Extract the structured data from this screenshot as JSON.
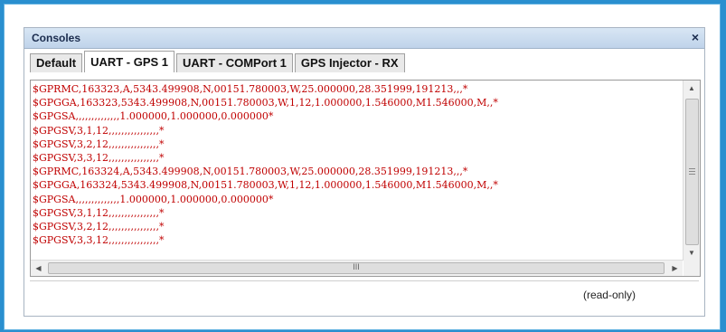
{
  "panel": {
    "title": "Consoles",
    "close_glyph": "×"
  },
  "tabs": [
    {
      "label": "Default",
      "active": false
    },
    {
      "label": "UART - GPS 1",
      "active": true
    },
    {
      "label": "UART - COMPort 1",
      "active": false
    },
    {
      "label": "GPS Injector - RX",
      "active": false
    }
  ],
  "console": {
    "text_color": "#c00000",
    "lines": [
      "$GPRMC,163323,A,5343.499908,N,00151.780003,W,25.000000,28.351999,191213,,,*",
      "$GPGGA,163323,5343.499908,N,00151.780003,W,1,12,1.000000,1.546000,M1.546000,M,,*",
      "$GPGSA,,,,,,,,,,,,,,1.000000,1.000000,0.000000*",
      "$GPGSV,3,1,12,,,,,,,,,,,,,,,,*",
      "$GPGSV,3,2,12,,,,,,,,,,,,,,,,*",
      "$GPGSV,3,3,12,,,,,,,,,,,,,,,,*",
      "$GPRMC,163324,A,5343.499908,N,00151.780003,W,25.000000,28.351999,191213,,,*",
      "$GPGGA,163324,5343.499908,N,00151.780003,W,1,12,1.000000,1.546000,M1.546000,M,,*",
      "$GPGSA,,,,,,,,,,,,,,1.000000,1.000000,0.000000*",
      "$GPGSV,3,1,12,,,,,,,,,,,,,,,,*",
      "$GPGSV,3,2,12,,,,,,,,,,,,,,,,*",
      "$GPGSV,3,3,12,,,,,,,,,,,,,,,,*"
    ]
  },
  "scrollbars": {
    "vertical": {
      "up_icon": "scroll-up-arrow-icon",
      "down_icon": "scroll-down-arrow-icon",
      "grip_icon": "scroll-grip-icon"
    },
    "horizontal": {
      "left_icon": "scroll-left-arrow-icon",
      "right_icon": "scroll-right-arrow-icon",
      "grip": "III"
    }
  },
  "status": {
    "readonly_label": "(read-only)"
  },
  "colors": {
    "outer_background": "#2a8fcf",
    "titlebar": "#c9daee",
    "console_text": "#c00000"
  }
}
